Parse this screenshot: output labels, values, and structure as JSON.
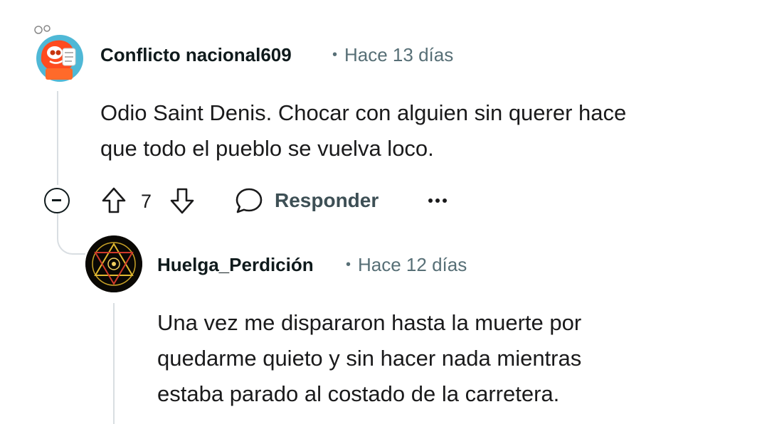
{
  "comments": [
    {
      "username": "Conflicto nacional609",
      "time": "Hace 13 días",
      "body_lines": [
        "Odio Saint Denis. Chocar con alguien sin querer hace",
        "que todo el pueblo se vuelva loco."
      ],
      "votes": "7",
      "reply_label": "Responder",
      "avatar_icon": "snoo-avatar-icon"
    },
    {
      "username": "Huelga_Perdición",
      "time": "Hace 12 días",
      "body_lines": [
        "Una vez me dispararon hasta la muerte por",
        "quedarme quieto y sin hacer nada mientras",
        "estaba parado al costado de la carretera."
      ],
      "avatar_icon": "mystic-symbol-avatar-icon"
    }
  ],
  "separator": "•",
  "icons": {
    "collapse": "collapse-minus-icon",
    "upvote": "upvote-arrow-icon",
    "downvote": "downvote-arrow-icon",
    "reply": "speech-bubble-icon",
    "more": "more-options-icon"
  },
  "colors": {
    "meta": "#576f76",
    "thread_line": "#d9dee2",
    "text": "#1a1a1b"
  }
}
